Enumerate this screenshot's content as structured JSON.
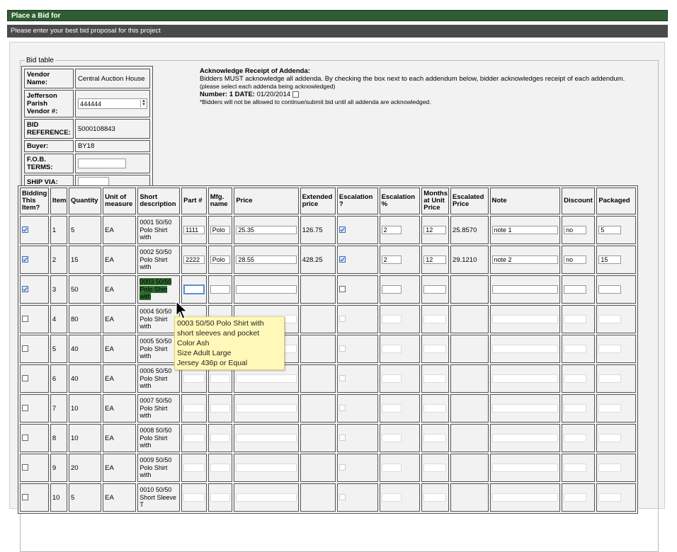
{
  "header": {
    "title": "Place a Bid for",
    "subtitle": "Please enter your best bid proposal for this project"
  },
  "bid_table_legend": "Bid table",
  "vendor": {
    "name_label": "Vendor Name:",
    "name_value": "Central Auction House",
    "parish_label": "Jefferson Parish Vendor #:",
    "parish_value": "444444",
    "bid_ref_label": "BID REFERENCE:",
    "bid_ref_value": "5000108843",
    "buyer_label": "Buyer:",
    "buyer_value": "BY18",
    "fob_label": "F.O.B. TERMS:",
    "fob_value": "",
    "ship_label": "SHIP VIA:",
    "ship_value": ""
  },
  "addenda": {
    "heading": "Acknowledge Receipt of Addenda:",
    "body": "Bidders MUST acknowledge all addenda. By checking the box next to each addendum below, bidder acknowledges receipt of each addendum.",
    "instruction": "(please select each addenda being acknowledged)",
    "number_label": "Number: 1 DATE:",
    "number_date": "01/20/2014",
    "note": "*Bidders will not be allowed to continue/submit bid until all addenda are acknowledged."
  },
  "columns": [
    "Bidding This Item?",
    "Item",
    "Quantity",
    "Unit of measure",
    "Short description",
    "Part #",
    "Mfg. name",
    "Price",
    "Extended price",
    "Escalation ?",
    "Escalation %",
    "Months at Unit Price",
    "Escalated Price",
    "Note",
    "Discount",
    "Packaged"
  ],
  "rows": [
    {
      "bid": true,
      "item": "1",
      "qty": "5",
      "uom": "EA",
      "desc": "0001 50/50 Polo Shirt with",
      "part": "1111",
      "mfg": "Polo",
      "price": "25.35",
      "ext": "126.75",
      "esc": true,
      "esc_pct": "2",
      "months": "12",
      "esc_price": "25.8570",
      "note": "note 1",
      "discount": "no",
      "packaged": "5"
    },
    {
      "bid": true,
      "item": "2",
      "qty": "15",
      "uom": "EA",
      "desc": "0002 50/50 Polo Shirt with",
      "part": "2222",
      "mfg": "Polo",
      "price": "28.55",
      "ext": "428.25",
      "esc": true,
      "esc_pct": "2",
      "months": "12",
      "esc_price": "29.1210",
      "note": "note 2",
      "discount": "no",
      "packaged": "15"
    },
    {
      "bid": true,
      "item": "3",
      "qty": "50",
      "uom": "EA",
      "desc": "0003 50/50 Polo Shirt with",
      "part": "",
      "mfg": "",
      "price": "",
      "ext": "",
      "esc": false,
      "esc_pct": "",
      "months": "",
      "esc_price": "",
      "note": "",
      "discount": "",
      "packaged": ""
    },
    {
      "bid": false,
      "item": "4",
      "qty": "80",
      "uom": "EA",
      "desc": "0004 50/50 Polo Shirt with",
      "part": "",
      "mfg": "",
      "price": "",
      "ext": "",
      "esc": false,
      "esc_pct": "",
      "months": "",
      "esc_price": "",
      "note": "",
      "discount": "",
      "packaged": ""
    },
    {
      "bid": false,
      "item": "5",
      "qty": "40",
      "uom": "EA",
      "desc": "0005 50/50 Polo Shirt with",
      "part": "",
      "mfg": "",
      "price": "",
      "ext": "",
      "esc": false,
      "esc_pct": "",
      "months": "",
      "esc_price": "",
      "note": "",
      "discount": "",
      "packaged": ""
    },
    {
      "bid": false,
      "item": "6",
      "qty": "40",
      "uom": "EA",
      "desc": "0006 50/50 Polo Shirt with",
      "part": "",
      "mfg": "",
      "price": "",
      "ext": "",
      "esc": false,
      "esc_pct": "",
      "months": "",
      "esc_price": "",
      "note": "",
      "discount": "",
      "packaged": ""
    },
    {
      "bid": false,
      "item": "7",
      "qty": "10",
      "uom": "EA",
      "desc": "0007 50/50 Polo Shirt with",
      "part": "",
      "mfg": "",
      "price": "",
      "ext": "",
      "esc": false,
      "esc_pct": "",
      "months": "",
      "esc_price": "",
      "note": "",
      "discount": "",
      "packaged": ""
    },
    {
      "bid": false,
      "item": "8",
      "qty": "10",
      "uom": "EA",
      "desc": "0008 50/50 Polo Shirt with",
      "part": "",
      "mfg": "",
      "price": "",
      "ext": "",
      "esc": false,
      "esc_pct": "",
      "months": "",
      "esc_price": "",
      "note": "",
      "discount": "",
      "packaged": ""
    },
    {
      "bid": false,
      "item": "9",
      "qty": "20",
      "uom": "EA",
      "desc": "0009 50/50 Polo Shirt with",
      "part": "",
      "mfg": "",
      "price": "",
      "ext": "",
      "esc": false,
      "esc_pct": "",
      "months": "",
      "esc_price": "",
      "note": "",
      "discount": "",
      "packaged": ""
    },
    {
      "bid": false,
      "item": "10",
      "qty": "5",
      "uom": "EA",
      "desc": "0010 50/50 Short Sleeve T",
      "part": "",
      "mfg": "",
      "price": "",
      "ext": "",
      "esc": false,
      "esc_pct": "",
      "months": "",
      "esc_price": "",
      "note": "",
      "discount": "",
      "packaged": ""
    }
  ],
  "tooltip": {
    "lines": [
      "0003 50/50 Polo Shirt with short sleeves and pocket",
      "Color Ash",
      "Size Adult Large",
      "Jersey 436p or Equal"
    ]
  },
  "colors": {
    "title_bar": "#2f5c32",
    "sub_bar": "#4a4a4a",
    "highlight": "#2e6b2e",
    "tooltip_bg": "#fff8b8"
  }
}
